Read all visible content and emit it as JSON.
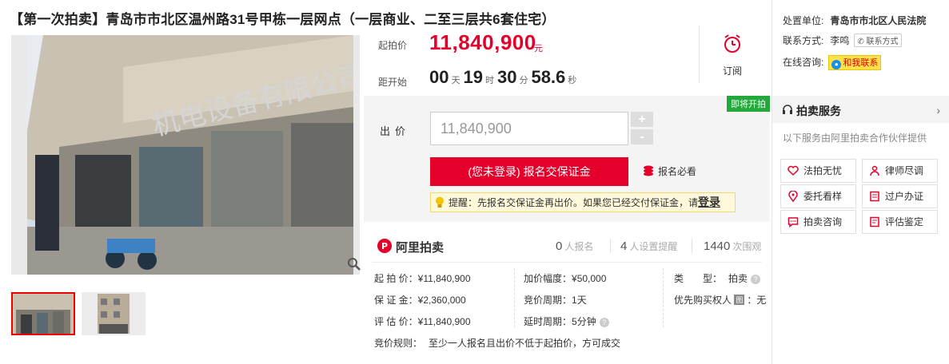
{
  "title": "【第一次拍卖】青岛市市北区温州路31号甲栋一层网点（一层商业、二至三层共6套住宅）",
  "price": {
    "start_label": "起拍价",
    "start_value": "11,840,900",
    "unit": "元",
    "countdown_label": "距开始",
    "days": "00",
    "days_unit": "天",
    "hours": "19",
    "hours_unit": "时",
    "minutes": "30",
    "minutes_unit": "分",
    "seconds": "58.6",
    "seconds_unit": "秒",
    "subscribe_label": "订阅"
  },
  "bid": {
    "badge": "即将开拍",
    "label": "出价",
    "input_value": "11,840,900",
    "plus": "+",
    "minus": "-",
    "signup_button": "(您未登录) 报名交保证金",
    "must_read": "报名必看",
    "tip_text": "提醒：先报名交保证金再出价。如果您已经交付保证金，请",
    "tip_login": "登录"
  },
  "info": {
    "brand": "阿里拍卖",
    "stats": [
      {
        "num": "0",
        "label": "人报名"
      },
      {
        "num": "4",
        "label": "人设置提醒"
      },
      {
        "num": "1440",
        "label": "次围观"
      }
    ],
    "col1": [
      {
        "label": "起 拍 价：",
        "value": "¥11,840,900"
      },
      {
        "label": "保 证 金：",
        "value": "¥2,360,000"
      },
      {
        "label": "评 估 价：",
        "value": "¥11,840,900"
      }
    ],
    "col2": [
      {
        "label": "加价幅度：",
        "value": "¥50,000"
      },
      {
        "label": "竞价周期：",
        "value": "1天"
      },
      {
        "label": "延时周期：",
        "value": "5分钟"
      }
    ],
    "type_label": "类　　型：",
    "type_value": "拍卖",
    "priority_label": "优先购买权人",
    "priority_badge": "图",
    "priority_value": "：无",
    "rule_label": "竞价规则：",
    "rule_value": "至少一人报名且出价不低于起拍价，方可成交"
  },
  "sidebar": {
    "unit_label": "处置单位:",
    "unit_value": "青岛市市北区人民法院",
    "contact_label": "联系方式:",
    "contact_name": "李鸣",
    "contact_button": "联系方式",
    "online_label": "在线咨询:",
    "online_button": "和我联系",
    "service_title": "拍卖服务",
    "service_desc": "以下服务由阿里拍卖合作伙伴提供",
    "services": [
      "法拍无忧",
      "律师尽调",
      "委托看样",
      "过户办证",
      "拍卖咨询",
      "评估鉴定"
    ]
  },
  "colors": {
    "accent_red": "#e4002b",
    "badge_green": "#23a93a"
  }
}
